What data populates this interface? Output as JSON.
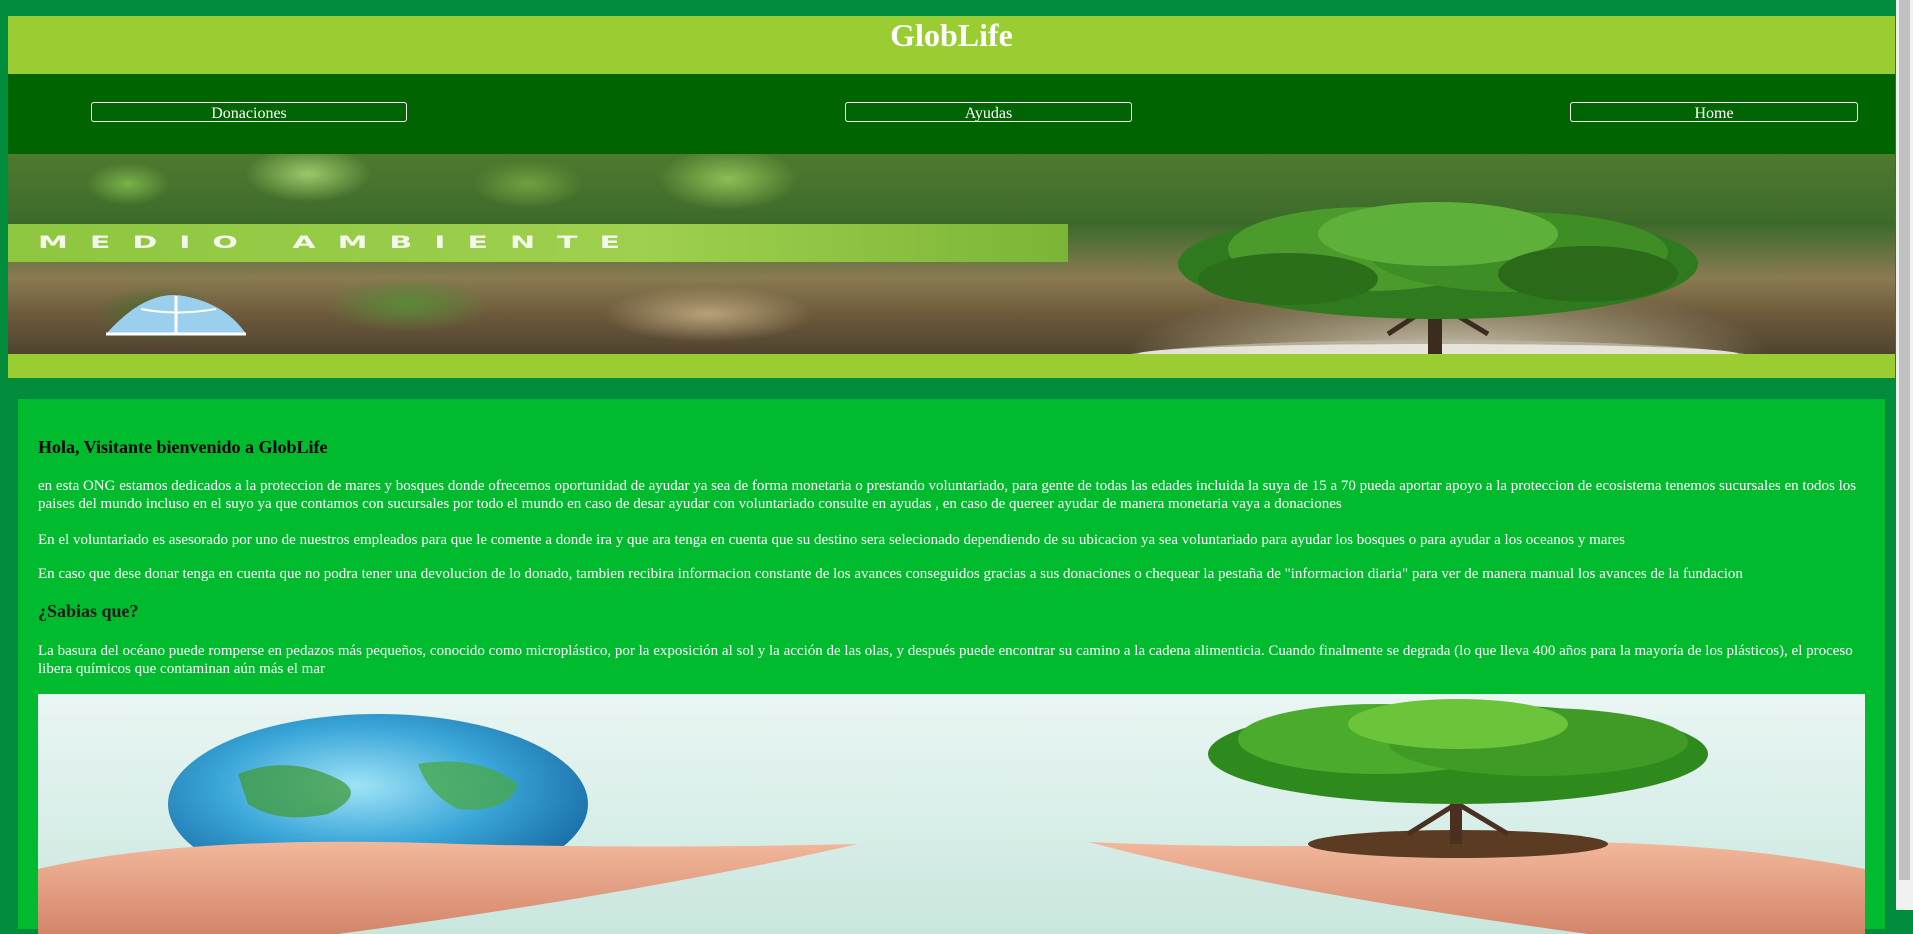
{
  "header": {
    "title": "GlobLife"
  },
  "nav": {
    "items": [
      {
        "label": "Donaciones"
      },
      {
        "label": "Ayudas"
      },
      {
        "label": "Home"
      }
    ]
  },
  "banner": {
    "text": "MEDIO AMBIENTE"
  },
  "content": {
    "welcome_heading": "Hola, Visitante bienvenido a GlobLife",
    "paragraphs": [
      "en esta ONG estamos dedicados a la proteccion de mares y bosques donde ofrecemos oportunidad de ayudar ya sea de forma monetaria o prestando voluntariado, para gente de todas las edades incluida la suya de 15 a 70 pueda aportar apoyo a la proteccion de ecosistema tenemos sucursales en todos los paises del mundo incluso en el suyo ya que contamos con sucursales por todo el mundo en caso de desar ayudar con voluntariado consulte en ayudas , en caso de quereer ayudar de manera monetaria vaya a donaciones",
      "En el voluntariado es asesorado por uno de nuestros empleados para que le comente a donde ira y que ara tenga en cuenta que su destino sera selecionado dependiendo de su ubicacion ya sea voluntariado para ayudar los bosques o para ayudar a los oceanos y mares",
      "En caso que dese donar tenga en cuenta que no podra tener una devolucion de lo donado, tambien recibira informacion constante de los avances conseguidos gracias a sus donaciones o chequear la pestaña de \"informacion diaria\" para ver de manera manual los avances de la fundacion"
    ],
    "fact_heading": "¿Sabias que?",
    "fact_text": "La basura del océano puede romperse en pedazos más pequeños, conocido como microplástico, por la exposición al sol y la acción de las olas, y después puede encontrar su camino a la cadena alimenticia. Cuando finalmente se degrada (lo que lleva 400 años para la mayoría de los plásticos), el proceso libera químicos que contaminan aún más el mar"
  },
  "colors": {
    "background": "#008c3a",
    "title_bar": "#9acd32",
    "nav_bar": "#006400",
    "content_bg": "#00bb2d"
  }
}
